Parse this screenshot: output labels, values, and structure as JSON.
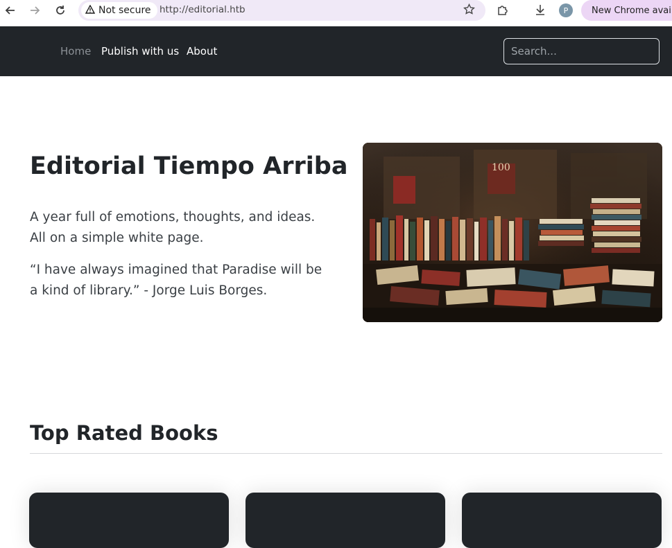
{
  "browser": {
    "security_label": "Not secure",
    "url": "http://editorial.htb",
    "profile_initial": "P",
    "update_label": "New Chrome available"
  },
  "navbar": {
    "links": [
      "Home",
      "Publish with us",
      "About"
    ],
    "search_placeholder": "Search..."
  },
  "hero": {
    "title": "Editorial Tiempo Arriba",
    "paragraph1": "A year full of emotions, thoughts, and ideas. All on a simple white page.",
    "paragraph2": "“I have always imagined that Paradise will be a kind of library.” - Jorge Luis Borges."
  },
  "section": {
    "title": "Top Rated Books"
  },
  "icons": [
    "back-arrow-icon",
    "forward-arrow-icon",
    "reload-icon",
    "warning-icon",
    "star-icon",
    "extensions-icon",
    "download-icon"
  ],
  "colors": {
    "navbar_bg": "#212529",
    "nav_active": "#8c9196",
    "card_bg": "#212529"
  }
}
